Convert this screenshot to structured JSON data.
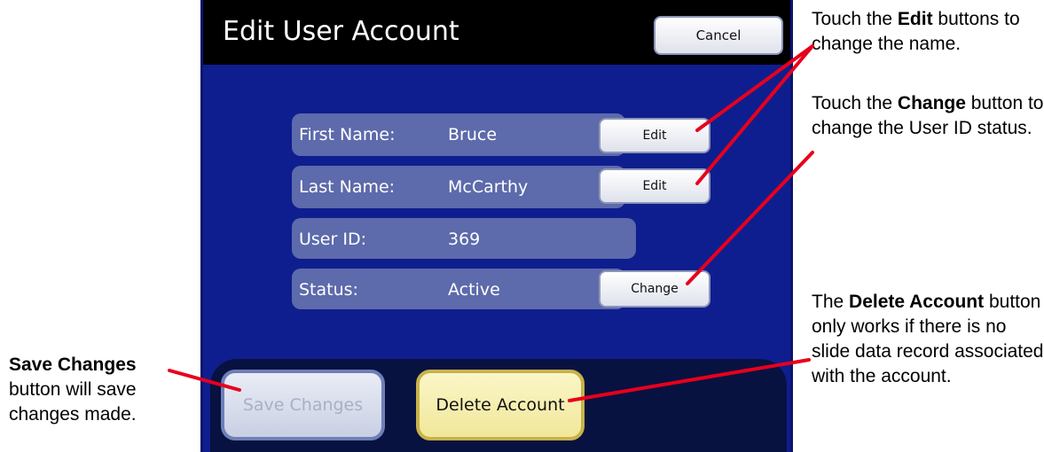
{
  "screen": {
    "title": "Edit User Account",
    "cancel_label": "Cancel",
    "fields": [
      {
        "label": "First Name:",
        "value": "Bruce",
        "action": "Edit"
      },
      {
        "label": "Last Name:",
        "value": "McCarthy",
        "action": "Edit"
      },
      {
        "label": "User ID:",
        "value": "369"
      },
      {
        "label": "Status:",
        "value": "Active",
        "action": "Change"
      }
    ],
    "save_label": "Save Changes",
    "delete_label": "Delete Account"
  },
  "annotations": {
    "edit_note": {
      "pre": "Touch the ",
      "bold": "Edit",
      "post": " buttons to change the name."
    },
    "change_note": {
      "pre": "Touch the ",
      "bold": "Change",
      "post": " button to change the User ID status."
    },
    "delete_note": {
      "pre": "The ",
      "bold": "Delete Account",
      "post": " button only works if there is no slide data record associated with the account."
    },
    "save_note": {
      "bold": "Save Changes",
      "post": " button will save changes made."
    }
  },
  "colors": {
    "screen_bg": "#0f1e8e",
    "row_bg": "#5d6aab",
    "callout_line": "#e8001c"
  }
}
